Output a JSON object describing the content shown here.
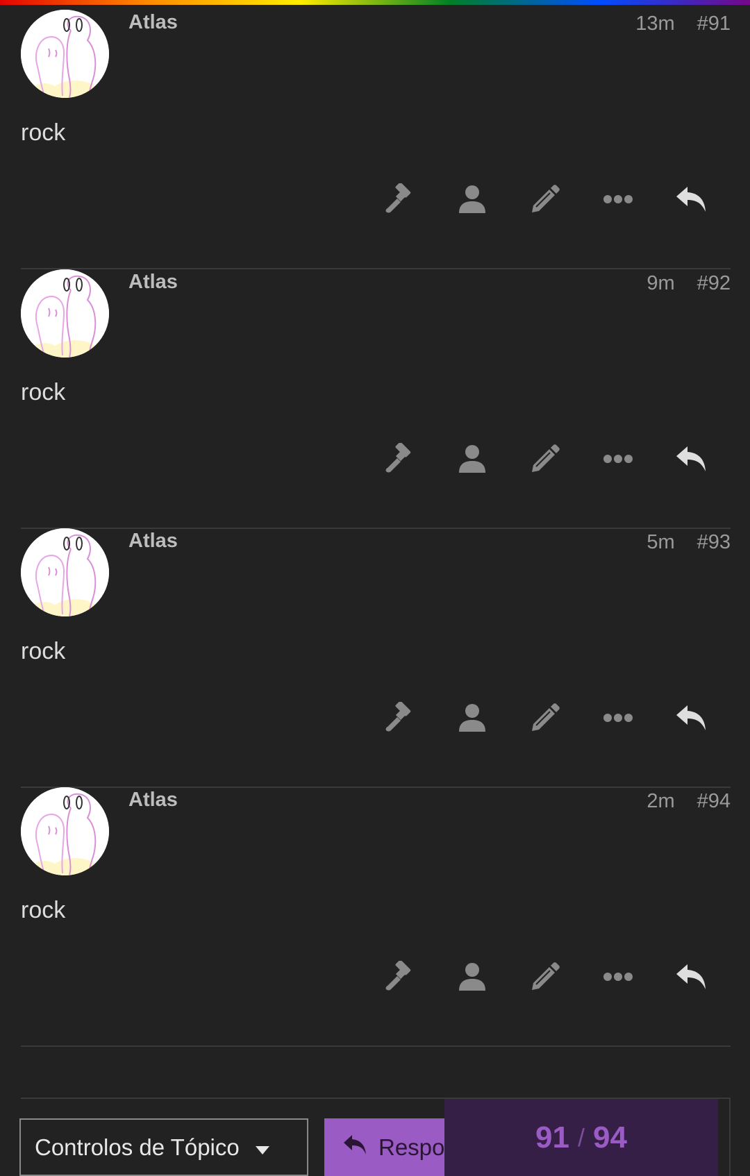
{
  "posts": [
    {
      "username": "Atlas",
      "time": "13m",
      "number": "#91",
      "content": "rock"
    },
    {
      "username": "Atlas",
      "time": "9m",
      "number": "#92",
      "content": "rock"
    },
    {
      "username": "Atlas",
      "time": "5m",
      "number": "#93",
      "content": "rock"
    },
    {
      "username": "Atlas",
      "time": "2m",
      "number": "#94",
      "content": "rock"
    }
  ],
  "post_actions": [
    "gavel-icon",
    "user-icon",
    "pencil-icon",
    "ellipsis-icon",
    "reply-icon"
  ],
  "footer": {
    "topic_controls_label": "Controlos de Tópico",
    "reply_label": "Responder",
    "progress_current": "91",
    "progress_separator": "/",
    "progress_total": "94"
  },
  "colors": {
    "background": "#222222",
    "accent": "#9a5bc4",
    "progress_bg": "#361f47",
    "icon": "#8a8a8a"
  }
}
